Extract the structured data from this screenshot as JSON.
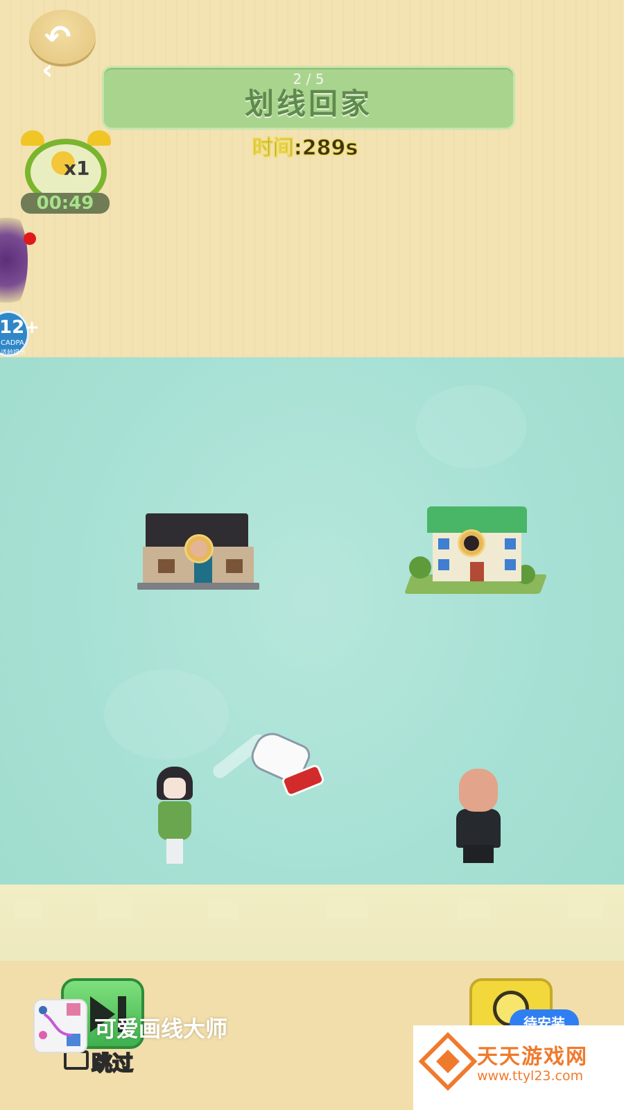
{
  "header": {
    "level_indicator": "2 / 5",
    "title": "划线回家",
    "time_label": "时间:289s"
  },
  "hint": {
    "count": "x1",
    "timer": "00:49"
  },
  "age_rating": {
    "value": "12+",
    "line1": "CADPA",
    "line2": "适龄提示"
  },
  "bottom": {
    "skip_label": "跳过",
    "app_title": "可爱画线大师",
    "install_label": "待安装"
  },
  "watermark": {
    "title": "天天游戏网",
    "url": "www.ttyl23.com"
  },
  "colors": {
    "play_area": "#a6e0d4",
    "banner": "#a9d48e",
    "skip_button": "#3fb04e",
    "time_button": "#f2d83a",
    "watermark_accent": "#f07a2c"
  }
}
